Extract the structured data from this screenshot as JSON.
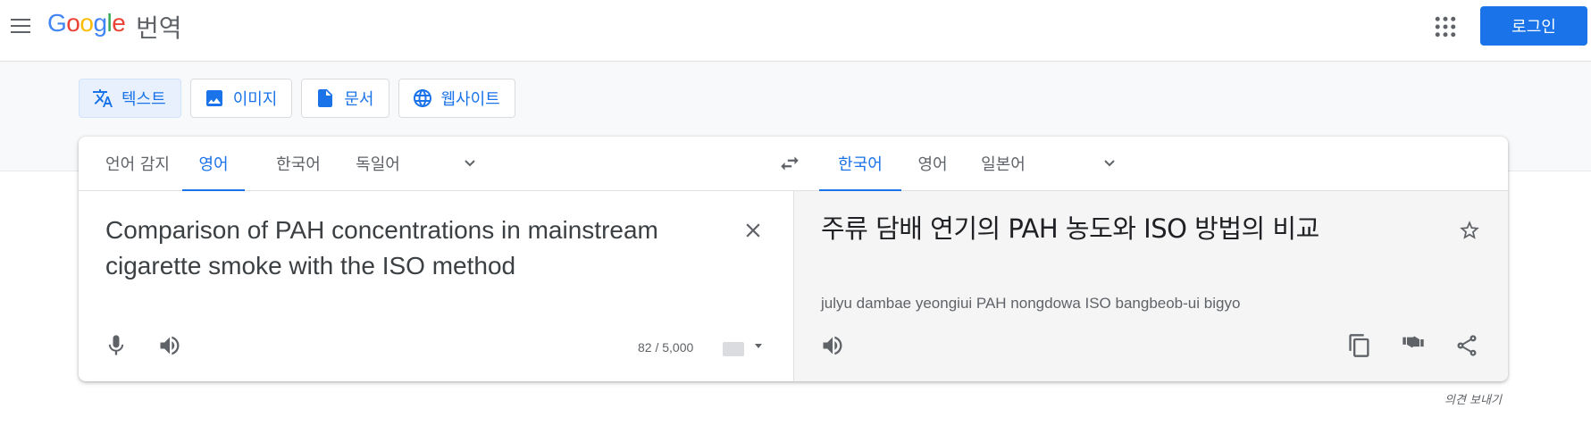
{
  "header": {
    "logo": [
      "G",
      "o",
      "o",
      "g",
      "l",
      "e"
    ],
    "product": "번역",
    "login_label": "로그인"
  },
  "mode_tabs": [
    {
      "label": "텍스트",
      "icon": "translate-icon",
      "active": true
    },
    {
      "label": "이미지",
      "icon": "image-icon",
      "active": false
    },
    {
      "label": "문서",
      "icon": "document-icon",
      "active": false
    },
    {
      "label": "웹사이트",
      "icon": "globe-icon",
      "active": false
    }
  ],
  "source": {
    "langs": [
      "언어 감지",
      "영어",
      "한국어",
      "독일어"
    ],
    "active_lang": "영어",
    "text": "Comparison of PAH concentrations in mainstream cigarette smoke with the ISO method",
    "char_count": "82 / 5,000"
  },
  "target": {
    "langs": [
      "한국어",
      "영어",
      "일본어"
    ],
    "active_lang": "한국어",
    "text": "주류 담배 연기의 PAH 농도와 ISO 방법의 비교",
    "transliteration": "julyu dambae yeongiui PAH nongdowa ISO bangbeob-ui bigyo"
  },
  "feedback_label": "의견 보내기",
  "colors": {
    "accent": "#1a73e8",
    "active_tab_bg": "#e8f0fe",
    "target_bg": "#f5f5f5"
  }
}
